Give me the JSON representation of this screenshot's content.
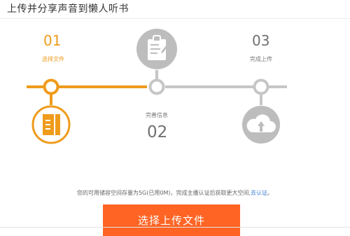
{
  "page": {
    "title": "上传并分享声音到懒人听书"
  },
  "steps": [
    {
      "number": "01",
      "label": "选择文件",
      "state": "active",
      "icon": "file-icon"
    },
    {
      "number": "02",
      "label": "完善信息",
      "state": "inactive",
      "icon": "clipboard-icon"
    },
    {
      "number": "03",
      "label": "完成上传",
      "state": "inactive",
      "icon": "cloud-upload-icon"
    }
  ],
  "storage": {
    "text": "您的可用储容空间存量为5G(已用0M)，完成主播认证后获取更大空间,",
    "link_label": "去认证",
    "trailing": "。"
  },
  "upload_button": {
    "label": "选择上传文件"
  },
  "colors": {
    "active": "#ef9b1c",
    "inactive": "#c6c6c6",
    "button": "#ff6424",
    "link": "#3b7fd6"
  }
}
